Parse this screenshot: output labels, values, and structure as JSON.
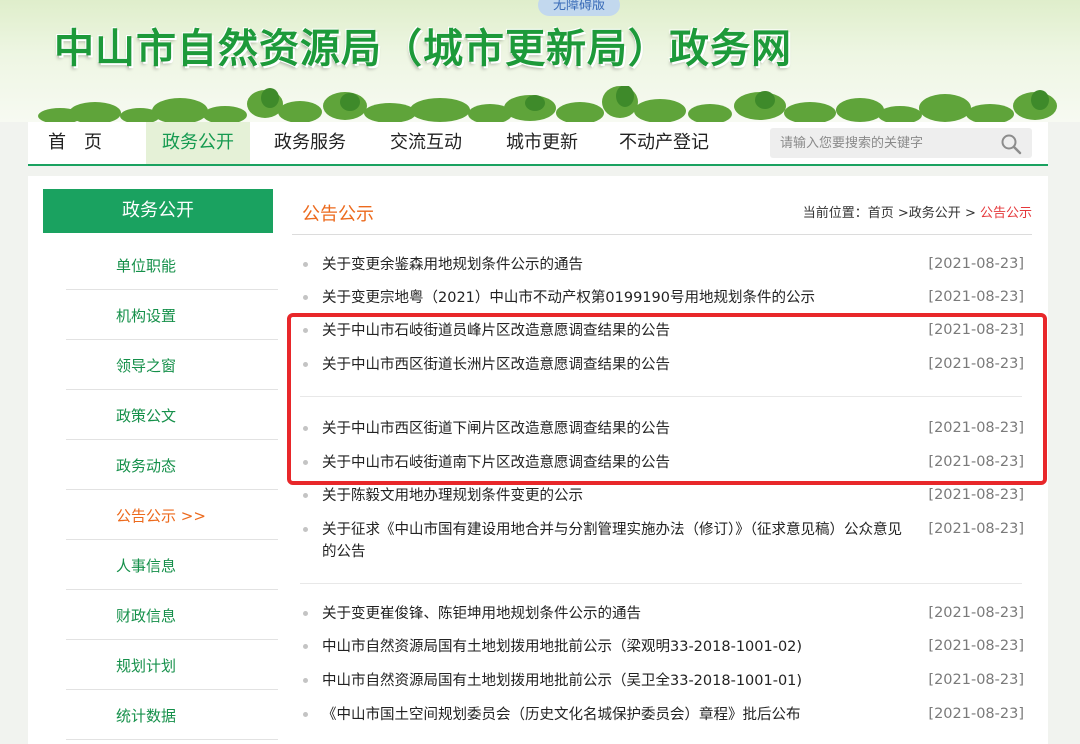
{
  "header": {
    "accessible_label": "无障碍版",
    "site_title": "中山市自然资源局（城市更新局）政务网"
  },
  "nav": {
    "items": [
      {
        "label": "首　页",
        "active": false
      },
      {
        "label": "政务公开",
        "active": true
      },
      {
        "label": "政务服务",
        "active": false
      },
      {
        "label": "交流互动",
        "active": false
      },
      {
        "label": "城市更新",
        "active": false
      },
      {
        "label": "不动产登记",
        "active": false
      }
    ],
    "search_placeholder": "请输入您要搜索的关键字"
  },
  "sidebar": {
    "title": "政务公开",
    "items": [
      {
        "label": "单位职能"
      },
      {
        "label": "机构设置"
      },
      {
        "label": "领导之窗"
      },
      {
        "label": "政策公文"
      },
      {
        "label": "政务动态"
      },
      {
        "label": "公告公示 >>",
        "active": true
      },
      {
        "label": "人事信息"
      },
      {
        "label": "财政信息"
      },
      {
        "label": "规划计划"
      },
      {
        "label": "统计数据"
      }
    ]
  },
  "main": {
    "section_title": "公告公示",
    "breadcrumb": {
      "prefix": "当前位置：",
      "home": "首页",
      "sep1": " >",
      "level1": "政务公开",
      "sep2": " > ",
      "current": "公告公示"
    },
    "notices": [
      {
        "title": "关于变更余鉴森用地规划条件公示的通告",
        "date": "[2021-08-23]"
      },
      {
        "title": "关于变更宗地粤（2021）中山市不动产权第0199190号用地规划条件的公示",
        "date": "[2021-08-23]"
      },
      {
        "title": "关于中山市石岐街道员峰片区改造意愿调查结果的公告",
        "date": "[2021-08-23]"
      },
      {
        "title": "关于中山市西区街道长洲片区改造意愿调查结果的公告",
        "date": "[2021-08-23]"
      },
      {
        "title": "关于中山市西区街道下闸片区改造意愿调查结果的公告",
        "date": "[2021-08-23]"
      },
      {
        "title": "关于中山市石岐街道南下片区改造意愿调查结果的公告",
        "date": "[2021-08-23]"
      },
      {
        "title": "关于陈毅文用地办理规划条件变更的公示",
        "date": "[2021-08-23]"
      },
      {
        "title": "关于征求《中山市国有建设用地合并与分割管理实施办法（修订）》（征求意见稿）公众意见的公告",
        "date": "[2021-08-23]"
      },
      {
        "title": "关于变更崔俊锋、陈钜坤用地规划条件公示的通告",
        "date": "[2021-08-23]"
      },
      {
        "title": "中山市自然资源局国有土地划拨用地批前公示（梁观明33-2018-1001-02)",
        "date": "[2021-08-23]"
      },
      {
        "title": "中山市自然资源局国有土地划拨用地批前公示（吴卫全33-2018-1001-01)",
        "date": "[2021-08-23]"
      },
      {
        "title": "《中山市国土空间规划委员会（历史文化名城保护委员会）章程》批后公布",
        "date": "[2021-08-23]"
      }
    ]
  },
  "colors": {
    "brand_green": "#1aa260",
    "title_green": "#1d9a3a",
    "accent_orange": "#ec6a1d",
    "highlight_red": "#e8272a"
  }
}
